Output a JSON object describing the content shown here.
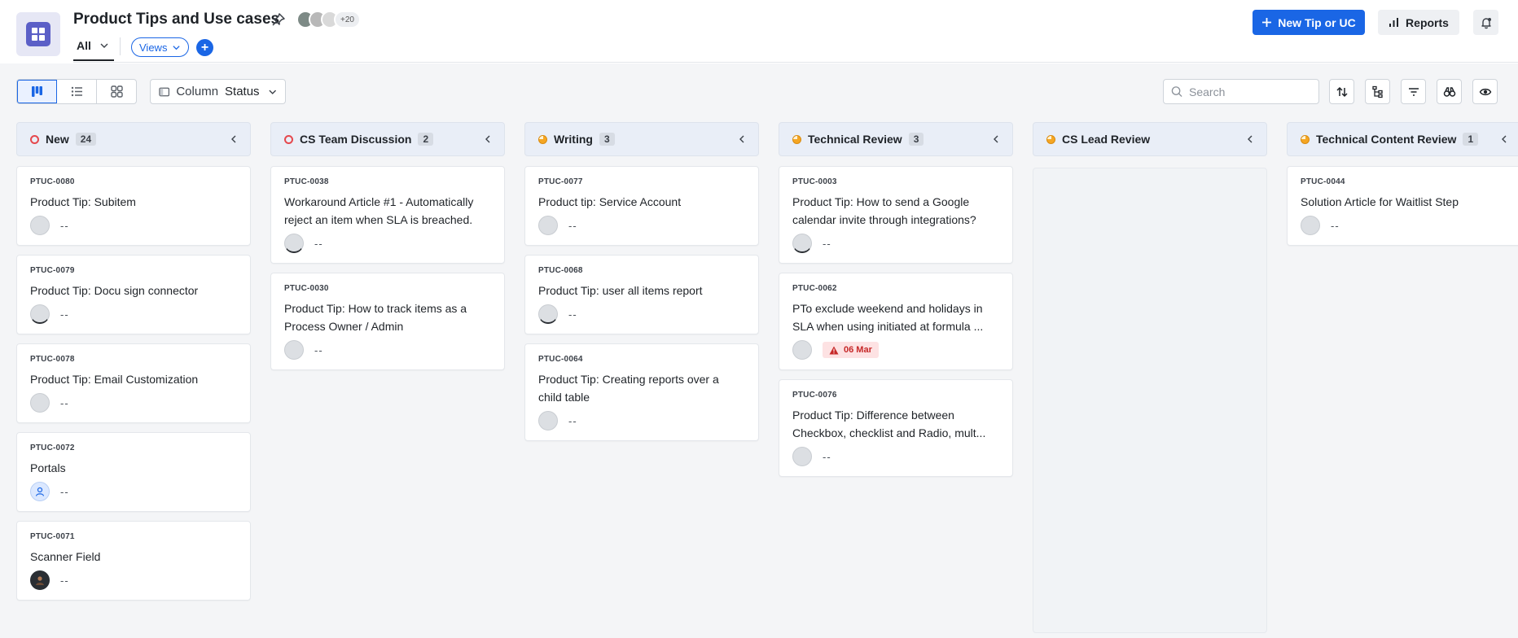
{
  "header": {
    "title": "Product Tips and Use cases",
    "collaborators_more": "+20",
    "view_name": "All",
    "views_label": "Views",
    "add_view_label": "+",
    "new_button_label": "New Tip or UC",
    "reports_label": "Reports"
  },
  "toolbar": {
    "column_label": "Column",
    "column_value": "Status",
    "search_placeholder": "Search"
  },
  "colors": {
    "accent": "#1a66e5",
    "status_open": "#e5484d",
    "status_in_progress": "#f5a623",
    "overdue_bg": "#fde2e3",
    "overdue_text": "#c62828"
  },
  "columns": [
    {
      "title": "New",
      "count": "24",
      "status": "open",
      "cards": [
        {
          "id": "PTUC-0080",
          "title": "Product Tip: Subitem",
          "assignee": "--",
          "avatar": "empty"
        },
        {
          "id": "PTUC-0079",
          "title": "Product Tip: Docu sign connector",
          "assignee": "--",
          "avatar": "empty"
        },
        {
          "id": "PTUC-0078",
          "title": "Product Tip: Email Customization",
          "assignee": "--",
          "avatar": "empty"
        },
        {
          "id": "PTUC-0072",
          "title": "Portals",
          "assignee": "--",
          "avatar": "user-icon"
        },
        {
          "id": "PTUC-0071",
          "title": "Scanner Field",
          "assignee": "--",
          "avatar": "photo"
        }
      ]
    },
    {
      "title": "CS Team Discussion",
      "count": "2",
      "status": "open",
      "cards": [
        {
          "id": "PTUC-0038",
          "title": "Workaround Article #1 - Automatically reject an item when SLA is breached.",
          "assignee": "--",
          "avatar": "empty"
        },
        {
          "id": "PTUC-0030",
          "title": "Product Tip: How to track items as a Process Owner / Admin",
          "assignee": "--",
          "avatar": "empty"
        }
      ]
    },
    {
      "title": "Writing",
      "count": "3",
      "status": "in-progress",
      "cards": [
        {
          "id": "PTUC-0077",
          "title": "Product tip: Service Account",
          "assignee": "--",
          "avatar": "empty"
        },
        {
          "id": "PTUC-0068",
          "title": "Product Tip: user all items report",
          "assignee": "--",
          "avatar": "empty"
        },
        {
          "id": "PTUC-0064",
          "title": "Product Tip: Creating reports over a child table",
          "assignee": "--",
          "avatar": "empty"
        }
      ]
    },
    {
      "title": "Technical Review",
      "count": "3",
      "status": "in-progress",
      "cards": [
        {
          "id": "PTUC-0003",
          "title": "Product Tip: How to send a Google calendar invite through integrations?",
          "assignee": "--",
          "avatar": "empty"
        },
        {
          "id": "PTUC-0062",
          "title": "PTo exclude weekend and holidays in SLA when using initiated at formula ...",
          "assignee": "",
          "avatar": "empty",
          "due": "06 Mar"
        },
        {
          "id": "PTUC-0076",
          "title": "Product Tip: Difference between Checkbox, checklist and Radio, mult...",
          "assignee": "--",
          "avatar": "empty"
        }
      ]
    },
    {
      "title": "CS Lead Review",
      "count": "",
      "status": "in-progress",
      "cards": []
    },
    {
      "title": "Technical Content Review",
      "count": "1",
      "status": "in-progress",
      "cards": [
        {
          "id": "PTUC-0044",
          "title": "Solution Article for Waitlist Step",
          "assignee": "--",
          "avatar": "empty"
        }
      ]
    }
  ]
}
